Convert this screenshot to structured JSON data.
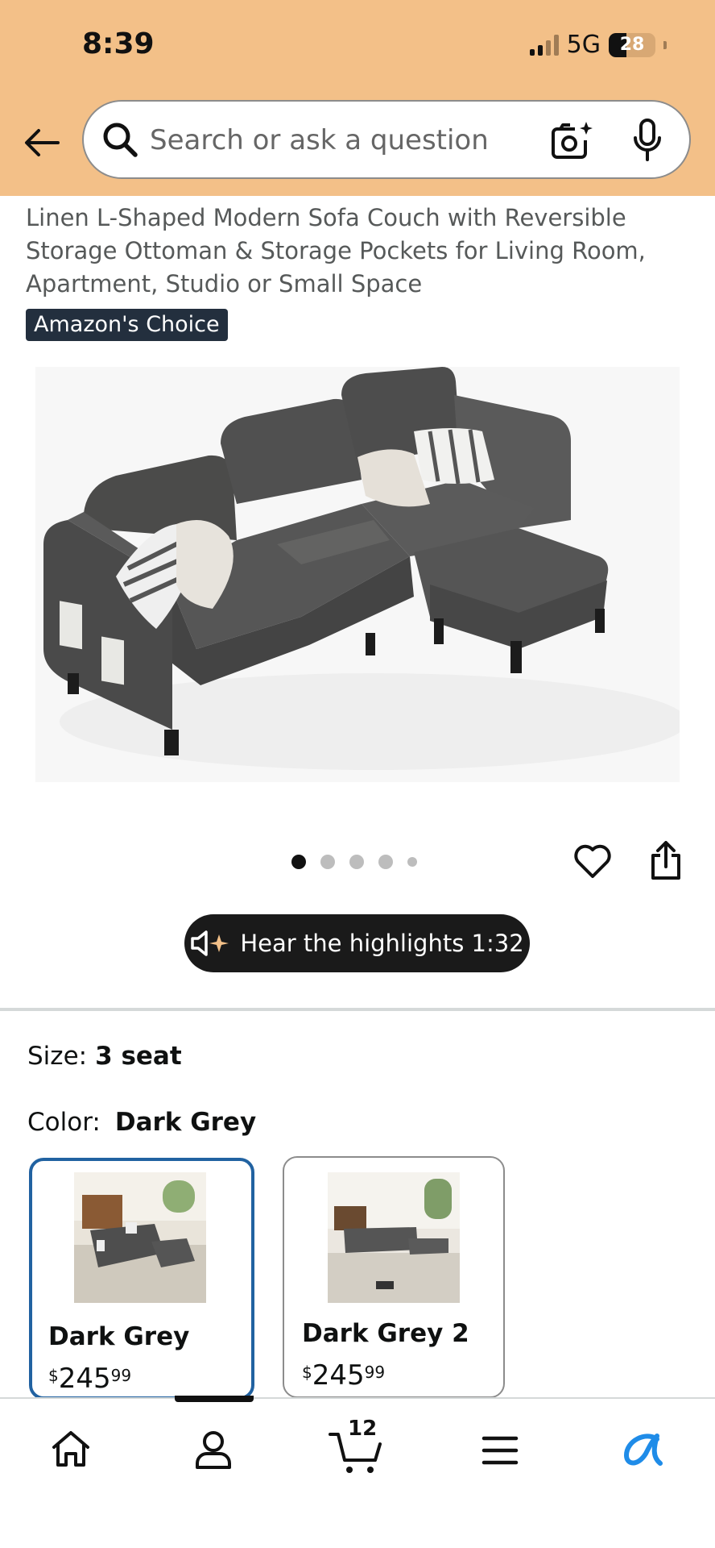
{
  "status_bar": {
    "time": "8:39",
    "network": "5G",
    "battery": "28"
  },
  "search": {
    "placeholder": "Search or ask a question"
  },
  "product": {
    "title": "Linen L-Shaped Modern Sofa Couch with Reversible Storage Ottoman & Storage Pockets for Living Room, Apartment, Studio or Small Space",
    "badge": "Amazon's Choice",
    "image_count": 5,
    "active_image": 1
  },
  "hear_highlights": {
    "label": "Hear the highlights 1:32"
  },
  "options": {
    "size_label": "Size:",
    "size_value": "3 seat",
    "color_label": "Color:",
    "color_value": "Dark Grey",
    "swatches": [
      {
        "name": "Dark Grey",
        "currency": "$",
        "price_whole": "245",
        "price_cents": "99",
        "selected": true
      },
      {
        "name": "Dark Grey 2",
        "currency": "$",
        "price_whole": "245",
        "price_cents": "99",
        "selected": false
      }
    ]
  },
  "bottom_nav": {
    "cart_count": "12",
    "items": [
      "home-icon",
      "account-icon",
      "cart-icon",
      "menu-icon",
      "rufus-icon"
    ]
  },
  "colors": {
    "header_bg": "#f3c088",
    "badge_bg": "#232f3e",
    "selected_border": "#2162a1",
    "rufus_blue": "#1f8ce8"
  }
}
